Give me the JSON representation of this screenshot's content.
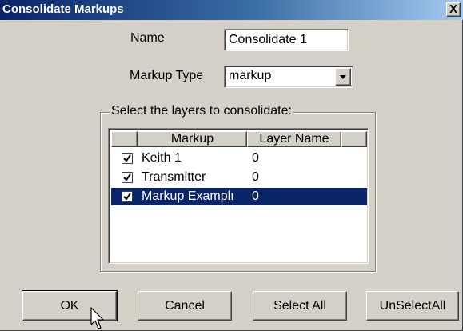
{
  "window": {
    "title": "Consolidate Markups",
    "close_label": "X"
  },
  "form": {
    "name_label": "Name",
    "name_value": "Consolidate 1",
    "markup_type_label": "Markup Type",
    "markup_type_value": "markup"
  },
  "layers_group": {
    "legend": "Select the layers to consolidate:",
    "columns": [
      "Markup",
      "Layer Name"
    ],
    "rows": [
      {
        "markup": "Keith 1",
        "layer_name": "0",
        "checked": true,
        "selected": false
      },
      {
        "markup": "Transmitter",
        "layer_name": "0",
        "checked": true,
        "selected": false
      },
      {
        "markup": "Markup Examplı",
        "layer_name": "0",
        "checked": true,
        "selected": true
      }
    ]
  },
  "buttons": {
    "ok": "OK",
    "cancel": "Cancel",
    "select_all": "Select All",
    "unselect_all": "UnSelectAll"
  },
  "colors": {
    "title_bar": "#0a246a",
    "dialog_bg": "#d4d0c8",
    "selection": "#0a246a"
  }
}
